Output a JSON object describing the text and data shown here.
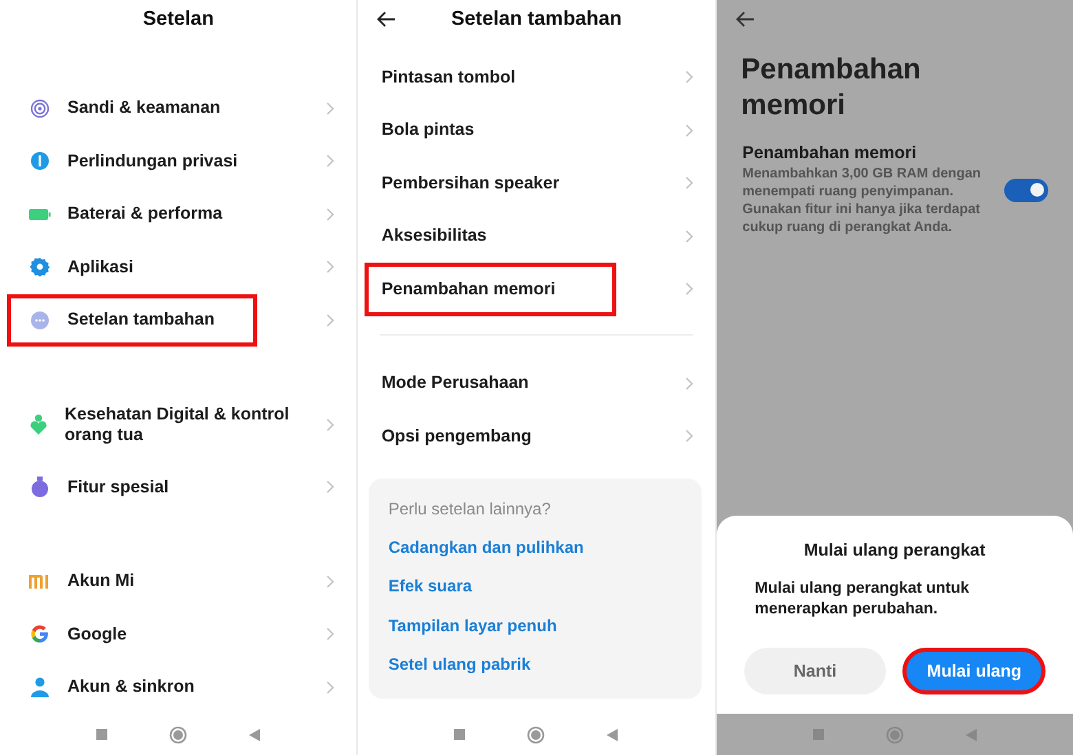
{
  "settings": {
    "title": "Setelan",
    "groups": [
      [
        {
          "label": "Sandi & keamanan",
          "highlighted": false
        },
        {
          "label": "Perlindungan privasi",
          "highlighted": false
        },
        {
          "label": "Baterai & performa",
          "highlighted": false
        },
        {
          "label": "Aplikasi",
          "highlighted": false
        },
        {
          "label": "Setelan tambahan",
          "highlighted": true
        }
      ],
      [
        {
          "label": "Kesehatan Digital & kontrol orang tua",
          "highlighted": false
        },
        {
          "label": "Fitur spesial",
          "highlighted": false
        }
      ],
      [
        {
          "label": "Akun Mi",
          "highlighted": false
        },
        {
          "label": "Google",
          "highlighted": false
        },
        {
          "label": "Akun & sinkron",
          "highlighted": false
        }
      ]
    ]
  },
  "extra": {
    "title": "Setelan tambahan",
    "groups": [
      [
        {
          "label": "Pintasan tombol",
          "highlighted": false
        },
        {
          "label": "Bola pintas",
          "highlighted": false
        },
        {
          "label": "Pembersihan speaker",
          "highlighted": false
        },
        {
          "label": "Aksesibilitas",
          "highlighted": false
        },
        {
          "label": "Penambahan memori",
          "highlighted": true
        }
      ],
      [
        {
          "label": "Mode Perusahaan",
          "highlighted": false
        },
        {
          "label": "Opsi pengembang",
          "highlighted": false
        }
      ]
    ],
    "more_card": {
      "heading": "Perlu setelan lainnya?",
      "links": [
        "Cadangkan dan pulihkan",
        "Efek suara",
        "Tampilan layar penuh",
        "Setel ulang pabrik"
      ]
    }
  },
  "memory": {
    "title": "Penambahan memori",
    "setting": {
      "title": "Penambahan memori",
      "description": "Menambahkan 3,00 GB RAM dengan menempati ruang penyimpanan. Gunakan fitur ini hanya jika terdapat cukup ruang di perangkat Anda.",
      "on": true
    },
    "dialog": {
      "title": "Mulai ulang perangkat",
      "message": "Mulai ulang perangkat untuk menerapkan perubahan.",
      "buttons": [
        {
          "label": "Nanti",
          "kind": "secondary",
          "highlighted": false
        },
        {
          "label": "Mulai ulang",
          "kind": "primary",
          "highlighted": true
        }
      ]
    }
  }
}
